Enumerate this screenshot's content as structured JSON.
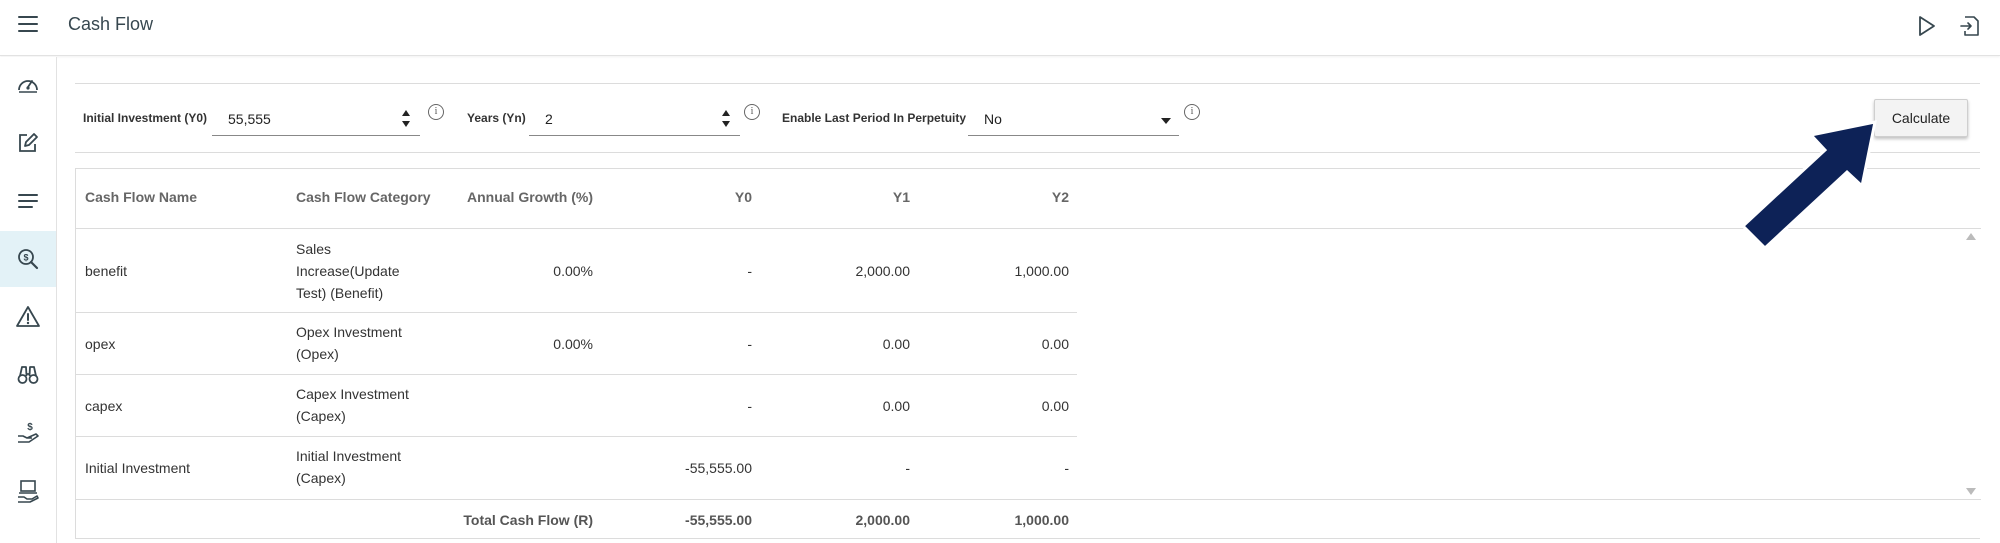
{
  "header": {
    "title": "Cash Flow",
    "icons": [
      "menu-icon",
      "play-icon",
      "export-icon"
    ]
  },
  "sidebar": {
    "items": [
      {
        "icon": "dashboard-icon"
      },
      {
        "icon": "edit-icon"
      },
      {
        "icon": "list-icon"
      },
      {
        "icon": "analysis-icon",
        "active": true
      },
      {
        "icon": "warning-icon"
      },
      {
        "icon": "binoculars-icon"
      },
      {
        "icon": "money-hand-icon"
      },
      {
        "icon": "laptop-hand-icon"
      }
    ]
  },
  "form": {
    "initial_investment_label": "Initial Investment (Y0)",
    "initial_investment_value": "55,555",
    "years_label": "Years (Yn)",
    "years_value": "2",
    "perpetuity_label": "Enable Last Period In Perpetuity",
    "perpetuity_value": "No",
    "info_glyph": "i",
    "calculate_label": "Calculate"
  },
  "table": {
    "columns": [
      "Cash Flow Name",
      "Cash Flow Category",
      "Annual Growth (%)",
      "Y0",
      "Y1",
      "Y2"
    ],
    "rows": [
      {
        "name": "benefit",
        "category": "Sales Increase(Update Test) (Benefit)",
        "growth": "0.00%",
        "y0": "-",
        "y1": "2,000.00",
        "y2": "1,000.00"
      },
      {
        "name": "opex",
        "category": "Opex Investment (Opex)",
        "growth": "0.00%",
        "y0": "-",
        "y1": "0.00",
        "y2": "0.00"
      },
      {
        "name": "capex",
        "category": "Capex Investment (Capex)",
        "growth": "",
        "y0": "-",
        "y1": "0.00",
        "y2": "0.00"
      },
      {
        "name": "Initial Investment",
        "category": "Initial Investment (Capex)",
        "growth": "",
        "y0": "-55,555.00",
        "y1": "-",
        "y2": "-"
      }
    ],
    "total": {
      "label": "Total Cash Flow (R)",
      "y0": "-55,555.00",
      "y1": "2,000.00",
      "y2": "1,000.00"
    }
  },
  "colors": {
    "annotation_arrow": "#0d2257",
    "sidebar_active_bg": "#e3f2f7",
    "icon_stroke": "#37474f"
  }
}
